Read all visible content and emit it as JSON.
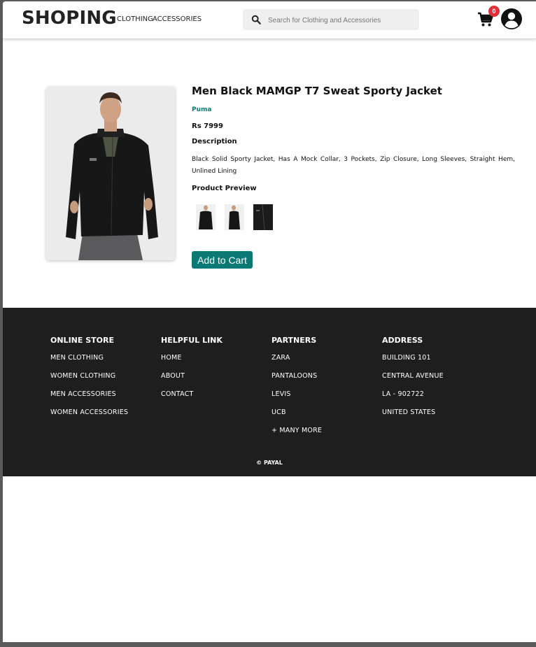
{
  "header": {
    "brand": "SHOPING",
    "nav": [
      "CLOTHING",
      "ACCESSORIES"
    ],
    "search_placeholder": "Search for Clothing and Accessories",
    "cart_count": "0"
  },
  "product": {
    "title": "Men Black MAMGP T7 Sweat Sporty Jacket",
    "brand": "Puma",
    "price": "Rs 7999",
    "description_heading": "Description",
    "description": "Black Solid Sporty Jacket, Has A Mock Collar, 3 Pockets, Zip Closure, Long Sleeves, Straight Hem, Unlined Lining",
    "preview_heading": "Product Preview",
    "add_to_cart": "Add to Cart"
  },
  "footer": {
    "columns": [
      {
        "heading": "ONLINE STORE",
        "links": [
          "MEN CLOTHING",
          "WOMEN CLOTHING",
          "MEN ACCESSORIES",
          "WOMEN ACCESSORIES"
        ]
      },
      {
        "heading": "HELPFUL LINK",
        "links": [
          "HOME",
          "ABOUT",
          "CONTACT"
        ]
      },
      {
        "heading": "PARTNERS",
        "links": [
          "ZARA",
          "PANTALOONS",
          "LEVIS",
          "UCB",
          "+ MANY MORE"
        ]
      },
      {
        "heading": "ADDRESS",
        "links": [
          "BUILDING 101",
          "CENTRAL AVENUE",
          "LA - 902722",
          "UNITED STATES"
        ]
      }
    ],
    "copyright": "© PAYAL"
  },
  "colors": {
    "accent": "#0b7a75",
    "footer_bg": "#1e1e1f",
    "badge": "#e0303a"
  }
}
